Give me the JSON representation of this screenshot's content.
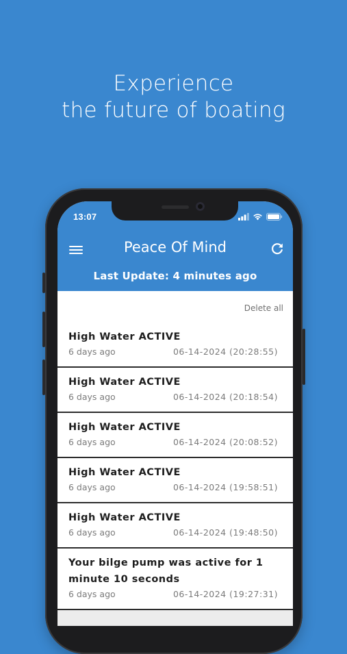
{
  "headline": {
    "line1": "Experience",
    "line2": "the future of boating"
  },
  "status_bar": {
    "time": "13:07"
  },
  "app_bar": {
    "title": "Peace Of Mind",
    "last_update": "Last Update: 4 minutes ago",
    "menu_icon": "hamburger-menu-icon",
    "refresh_icon": "refresh-icon"
  },
  "colors": {
    "brand_blue": "#3a87cf",
    "card_background": "#ffffff",
    "divider": "#2b2b2b"
  },
  "actions": {
    "delete_all": "Delete all"
  },
  "alerts": [
    {
      "title": "High Water ACTIVE",
      "relative": "6 days ago",
      "timestamp": "06-14-2024 (20:28:55)"
    },
    {
      "title": "High Water ACTIVE",
      "relative": "6 days ago",
      "timestamp": "06-14-2024 (20:18:54)"
    },
    {
      "title": "High Water ACTIVE",
      "relative": "6 days ago",
      "timestamp": "06-14-2024 (20:08:52)"
    },
    {
      "title": "High Water ACTIVE",
      "relative": "6 days ago",
      "timestamp": "06-14-2024 (19:58:51)"
    },
    {
      "title": "High Water ACTIVE",
      "relative": "6 days ago",
      "timestamp": "06-14-2024 (19:48:50)"
    },
    {
      "title": "Your bilge pump was active for 1 minute 10 seconds",
      "relative": "6 days ago",
      "timestamp": "06-14-2024 (19:27:31)"
    }
  ]
}
